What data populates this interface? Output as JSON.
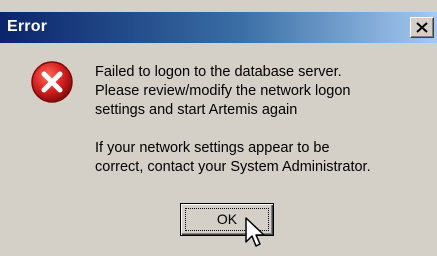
{
  "window": {
    "title": "Error"
  },
  "icons": {
    "error": "error-icon",
    "close": "close-icon",
    "cursor": "mouse-pointer-icon"
  },
  "message": {
    "lines": [
      "Failed to logon to the database server.",
      "Please review/modify the network logon",
      "settings and start Artemis again",
      "If your network settings appear to be",
      "correct, contact your System Administrator."
    ]
  },
  "buttons": {
    "ok_label": "OK"
  },
  "colors": {
    "title_start": "#0a246a",
    "title_end": "#a6caf0",
    "dialog_bg": "#d4d0c8",
    "error_red": "#d42020"
  }
}
